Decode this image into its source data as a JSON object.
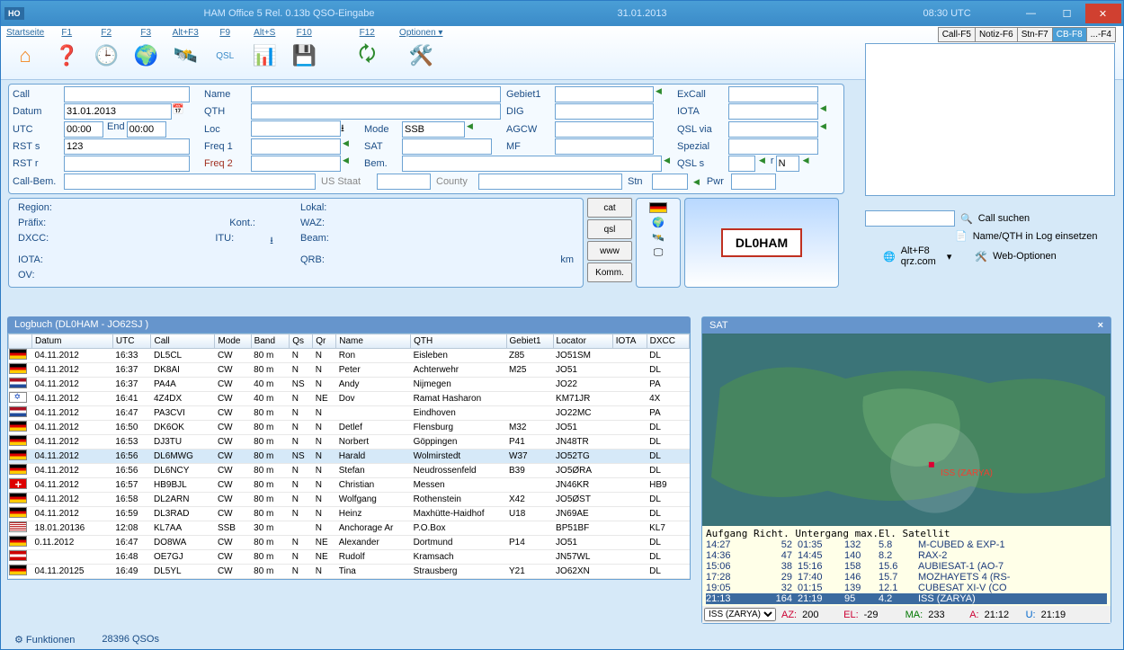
{
  "title": {
    "app": "HAM Office 5   Rel. 0.13b    QSO-Eingabe",
    "date": "31.01.2013",
    "time": "08:30 UTC"
  },
  "menu": {
    "items": [
      "Startseite",
      "F1",
      "F2",
      "F3",
      "Alt+F3",
      "F9",
      "Alt+S",
      "F10",
      "",
      "F12",
      "Optionen ▾"
    ]
  },
  "callsign": "DLØHAM",
  "tabs": [
    "Call-F5",
    "Notiz-F6",
    "Stn-F7",
    "CB-F8",
    "...-F4"
  ],
  "form": {
    "Call": "",
    "Datum": "31.01.2013",
    "UTC": "00:00",
    "End": "00:00",
    "RSTs": "123",
    "RSTr": "",
    "CallBem": "",
    "Name": "",
    "QTH": "",
    "Loc": "",
    "Mode": "SSB",
    "Freq1": "",
    "Freq2": "",
    "SAT": "",
    "Bem": "",
    "Gebiet1": "",
    "DIG": "",
    "AGCW": "",
    "MF": "",
    "ExCall": "",
    "IOTA": "",
    "QSLvia": "",
    "Spezial": "",
    "QSLs": "",
    "QSLdir": "N",
    "Stn": "",
    "Pwr": "",
    "USStaat": "",
    "County": ""
  },
  "labels": {
    "Call": "Call",
    "Datum": "Datum",
    "UTC": "UTC",
    "End": "End",
    "RSTs": "RST s",
    "RSTr": "RST r",
    "CallBem": "Call-Bem.",
    "Name": "Name",
    "QTH": "QTH",
    "Loc": "Loc",
    "Mode": "Mode",
    "Freq1": "Freq 1",
    "Freq2": "Freq 2",
    "SAT": "SAT",
    "Bem": "Bem.",
    "Gebiet1": "Gebiet1",
    "DIG": "DIG",
    "AGCW": "AGCW",
    "MF": "MF",
    "ExCall": "ExCall",
    "IOTA": "IOTA",
    "QSLvia": "QSL via",
    "Spezial": "Spezial",
    "QSLs": "QSL s",
    "Stn": "Stn",
    "Pwr": "Pwr",
    "USStaat": "US Staat",
    "County": "County"
  },
  "region": {
    "Region": "Region:",
    "Praefix": "Präfix:",
    "DXCC": "DXCC:",
    "IOTA": "IOTA:",
    "OV": "OV:",
    "Lokal": "Lokal:",
    "Kont": "Kont.:",
    "WAZ": "WAZ:",
    "ITU": "ITU:",
    "Beam": "Beam:",
    "QRB": "QRB:",
    "km": "km"
  },
  "minibtns": [
    "cat",
    "qsl",
    "www",
    "Komm."
  ],
  "flag": "DL0HAM",
  "actions": {
    "search": "Call suchen",
    "insert": "Name/QTH in Log einsetzen",
    "qrz": "Alt+F8\nqrz.com",
    "web": "Web-Optionen"
  },
  "log": {
    "title": "Logbuch  (DL0HAM - JO62SJ )",
    "cols": [
      "",
      "Datum",
      "UTC",
      "Call",
      "Mode",
      "Band",
      "Qs",
      "Qr",
      "Name",
      "QTH",
      "Gebiet1",
      "Locator",
      "IOTA",
      "DXCC"
    ],
    "rows": [
      [
        "de",
        "04.11.2012",
        "16:33",
        "DL5CL",
        "CW",
        "80 m",
        "N",
        "N",
        "Ron",
        "Eisleben",
        "Z85",
        "JO51SM",
        "",
        "DL"
      ],
      [
        "de",
        "04.11.2012",
        "16:37",
        "DK8AI",
        "CW",
        "80 m",
        "N",
        "N",
        "Peter",
        "Achterwehr",
        "M25",
        "JO51",
        "",
        "DL"
      ],
      [
        "nl",
        "04.11.2012",
        "16:37",
        "PA4A",
        "CW",
        "40 m",
        "NS",
        "N",
        "Andy",
        "Nijmegen",
        "",
        "JO22",
        "",
        "PA"
      ],
      [
        "il",
        "04.11.2012",
        "16:41",
        "4Z4DX",
        "CW",
        "40 m",
        "N",
        "NE",
        "Dov",
        "Ramat Hasharon",
        "",
        "KM71JR",
        "",
        "4X"
      ],
      [
        "nl",
        "04.11.2012",
        "16:47",
        "PA3CVI",
        "CW",
        "80 m",
        "N",
        "N",
        "",
        "Eindhoven",
        "",
        "JO22MC",
        "",
        "PA"
      ],
      [
        "de",
        "04.11.2012",
        "16:50",
        "DK6OK",
        "CW",
        "80 m",
        "N",
        "N",
        "Detlef",
        "Flensburg",
        "M32",
        "JO51",
        "",
        "DL"
      ],
      [
        "de",
        "04.11.2012",
        "16:53",
        "DJ3TU",
        "CW",
        "80 m",
        "N",
        "N",
        "Norbert",
        "Göppingen",
        "P41",
        "JN48TR",
        "",
        "DL"
      ],
      [
        "de",
        "04.11.2012",
        "16:56",
        "DL6MWG",
        "CW",
        "80 m",
        "NS",
        "N",
        "Harald",
        "Wolmirstedt",
        "W37",
        "JO52TG",
        "",
        "DL"
      ],
      [
        "de",
        "04.11.2012",
        "16:56",
        "DL6NCY",
        "CW",
        "80 m",
        "N",
        "N",
        "Stefan",
        "Neudrossenfeld",
        "B39",
        "JO5ØRA",
        "",
        "DL"
      ],
      [
        "ch",
        "04.11.2012",
        "16:57",
        "HB9BJL",
        "CW",
        "80 m",
        "N",
        "N",
        "Christian",
        "Messen",
        "",
        "JN46KR",
        "",
        "HB9"
      ],
      [
        "de",
        "04.11.2012",
        "16:58",
        "DL2ARN",
        "CW",
        "80 m",
        "N",
        "N",
        "Wolfgang",
        "Rothenstein",
        "X42",
        "JO5ØST",
        "",
        "DL"
      ],
      [
        "de",
        "04.11.2012",
        "16:59",
        "DL3RAD",
        "CW",
        "80 m",
        "N",
        "N",
        "Heinz",
        "Maxhütte-Haidhof",
        "U18",
        "JN69AE",
        "",
        "DL"
      ],
      [
        "us",
        "18.01.20136",
        "12:08",
        "KL7AA",
        "SSB",
        "30 m",
        "",
        "N",
        "Anchorage Ar",
        "P.O.Box",
        "",
        "BP51BF",
        "",
        "KL7"
      ],
      [
        "de",
        "0.11.2012",
        "16:47",
        "DO8WA",
        "CW",
        "80 m",
        "N",
        "NE",
        "Alexander",
        "Dortmund",
        "P14",
        "JO51",
        "",
        "DL"
      ],
      [
        "at",
        "",
        "16:48",
        "OE7GJ",
        "CW",
        "80 m",
        "N",
        "NE",
        "Rudolf",
        "Kramsach",
        "",
        "JN57WL",
        "",
        "DL"
      ],
      [
        "de",
        "04.11.20125",
        "16:49",
        "DL5YL",
        "CW",
        "80 m",
        "N",
        "N",
        "Tina",
        "Strausberg",
        "Y21",
        "JO62XN",
        "",
        "DL"
      ]
    ]
  },
  "status": {
    "func": "Funktionen",
    "count": "28396 QSOs"
  },
  "sat": {
    "title": "SAT",
    "label": "ISS (ZARYA)",
    "cols": "Aufgang Richt. Untergang max.El. Satellit",
    "rows": [
      [
        "14:27",
        "  52",
        "01:35",
        "132",
        " 5.8",
        "M-CUBED & EXP-1"
      ],
      [
        "14:36",
        "  47",
        "14:45",
        "140",
        " 8.2",
        "RAX-2"
      ],
      [
        "15:06",
        "  38",
        "15:16",
        "158",
        "15.6",
        "AUBIESAT-1 (AO-7"
      ],
      [
        "17:28",
        "  29",
        "17:40",
        "146",
        "15.7",
        "MOZHAYETS 4 (RS-"
      ],
      [
        "19:05",
        "  32",
        "01:15",
        "139",
        "12.1",
        "CUBESAT XI-V (CO"
      ],
      [
        "21:13",
        " 164",
        "21:19",
        " 95",
        " 4.2",
        "ISS (ZARYA)"
      ]
    ],
    "select": "ISS (ZARYA)",
    "foot": {
      "az": "AZ:",
      "azv": "200",
      "el": "EL:",
      "elv": "-29",
      "ma": "MA:",
      "mav": "233",
      "a": "A:",
      "av": "21:12",
      "u": "U:",
      "uv": "21:19"
    }
  }
}
